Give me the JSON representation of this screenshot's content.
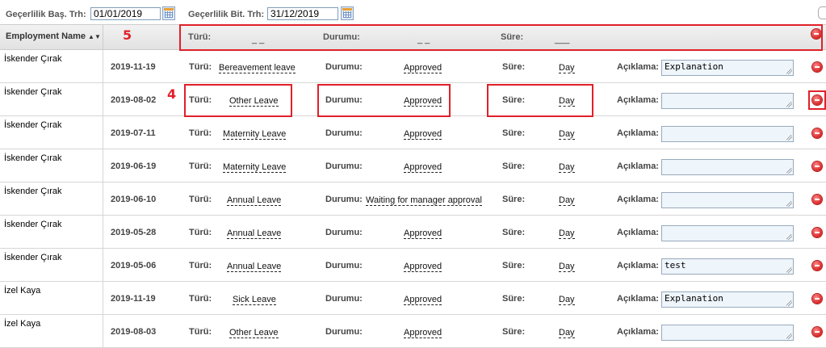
{
  "filters": {
    "start_label": "Geçerlilik Baş. Trh:",
    "start_value": "01/01/2019",
    "end_label": "Geçerlilik Bit. Trh:",
    "end_value": "31/12/2019"
  },
  "header": {
    "name_column": "Employment Name",
    "type_label": "Türü:",
    "type_value": "_ _",
    "status_label": "Durumu:",
    "status_value": "_ _",
    "duration_label": "Süre:",
    "duration_value": "___"
  },
  "row_labels": {
    "type": "Türü:",
    "status": "Durumu:",
    "duration": "Süre:",
    "note": "Açıklama:"
  },
  "rows": [
    {
      "name": "İskender Çırak",
      "date": "2019-11-19",
      "type": "Bereavement leave",
      "status": "Approved",
      "duration": "Day",
      "note": "Explanation"
    },
    {
      "name": "İskender Çırak",
      "date": "2019-08-02",
      "type": "Other Leave",
      "status": "Approved",
      "duration": "Day",
      "note": ""
    },
    {
      "name": "İskender Çırak",
      "date": "2019-07-11",
      "type": "Maternity Leave",
      "status": "Approved",
      "duration": "Day",
      "note": ""
    },
    {
      "name": "İskender Çırak",
      "date": "2019-06-19",
      "type": "Maternity Leave",
      "status": "Approved",
      "duration": "Day",
      "note": ""
    },
    {
      "name": "İskender Çırak",
      "date": "2019-06-10",
      "type": "Annual Leave",
      "status": "Waiting for manager approval",
      "duration": "Day",
      "note": ""
    },
    {
      "name": "İskender Çırak",
      "date": "2019-05-28",
      "type": "Annual Leave",
      "status": "Approved",
      "duration": "Day",
      "note": ""
    },
    {
      "name": "İskender Çırak",
      "date": "2019-05-06",
      "type": "Annual Leave",
      "status": "Approved",
      "duration": "Day",
      "note": "test"
    },
    {
      "name": "İzel Kaya",
      "date": "2019-11-19",
      "type": "Sick Leave",
      "status": "Approved",
      "duration": "Day",
      "note": "Explanation"
    },
    {
      "name": "İzel Kaya",
      "date": "2019-08-03",
      "type": "Other Leave",
      "status": "Approved",
      "duration": "Day",
      "note": ""
    }
  ],
  "annotations": {
    "header_marker": "5",
    "row_marker": "4"
  },
  "colors": {
    "annotation": "#e0202a",
    "remove": "#d62424",
    "note_bg": "#eef5fb"
  },
  "icons": {
    "calendar": "calendar-icon",
    "remove": "remove-icon",
    "sort": "sort-icon"
  }
}
